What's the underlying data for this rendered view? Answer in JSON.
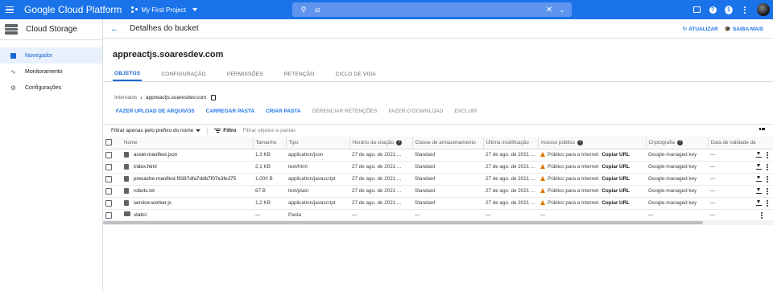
{
  "topbar": {
    "app_title": "Google Cloud Platform",
    "project": "My First Project",
    "search_value": "st",
    "notifications_count": "1"
  },
  "sidebar": {
    "title": "Cloud Storage",
    "items": [
      {
        "label": "Navegador",
        "icon": "bucket-icon",
        "active": true
      },
      {
        "label": "Monitoramento",
        "icon": "chart-icon",
        "active": false
      },
      {
        "label": "Configurações",
        "icon": "gear-icon",
        "active": false
      }
    ]
  },
  "header": {
    "title": "Detalhes do bucket",
    "refresh_label": "ATUALIZAR",
    "learn_label": "SAIBA MAIS"
  },
  "bucket": {
    "name": "appreactjs.soaresdev.com"
  },
  "tabs": [
    "OBJETOS",
    "CONFIGURAÇÃO",
    "PERMISSÕES",
    "RETENÇÃO",
    "CICLO DE VIDA"
  ],
  "breadcrumb": {
    "root": "Intervalos",
    "current": "appreactjs.soaresdev.com"
  },
  "actions": {
    "upload_files": "FAZER UPLOAD DE ARQUIVOS",
    "upload_folder": "CARREGAR PASTA",
    "create_folder": "CRIAR PASTA",
    "manage_retention": "GERENCIAR RETENÇÕES",
    "download": "FAZER O DOWNLOAD",
    "delete": "EXCLUIR"
  },
  "filter": {
    "select_label": "Filtrar apenas pelo prefixo do nome",
    "filter_label": "Filtro",
    "placeholder": "Filtrar objetos e pastas"
  },
  "table": {
    "columns": {
      "name": "Nome",
      "size": "Tamanho",
      "type": "Tipo",
      "created": "Horário da criação",
      "storage_class": "Classe de armazenamento",
      "modified": "Última modificação",
      "public_access": "Acesso público",
      "encryption": "Criptografia",
      "retention": "Data de validade da"
    },
    "rows": [
      {
        "name": "asset-manifest.json",
        "size": "1,3 KB",
        "type": "application/json",
        "created": "27 de ago. de 2021 ...",
        "storage_class": "Standard",
        "modified": "27 de ago. de 2021 ...",
        "access": "Público para a Internet",
        "copy": "Copiar URL",
        "encryption": "Google-managed key",
        "retention": "—"
      },
      {
        "name": "index.html",
        "size": "2,1 KB",
        "type": "text/html",
        "created": "27 de ago. de 2021 ...",
        "storage_class": "Standard",
        "modified": "27 de ago. de 2021 ...",
        "access": "Público para a Internet",
        "copy": "Copiar URL",
        "encryption": "Google-managed key",
        "retention": "—"
      },
      {
        "name": "precache-manifest.f9387dfa7ddb7f07e3fe375",
        "size": "1.000 B",
        "type": "application/javascript",
        "created": "27 de ago. de 2021 ...",
        "storage_class": "Standard",
        "modified": "27 de ago. de 2021 ...",
        "access": "Público para a Internet",
        "copy": "Copiar URL",
        "encryption": "Google-managed key",
        "retention": "—"
      },
      {
        "name": "robots.txt",
        "size": "67 B",
        "type": "text/plain",
        "created": "27 de ago. de 2021 ...",
        "storage_class": "Standard",
        "modified": "27 de ago. de 2021 ...",
        "access": "Público para a Internet",
        "copy": "Copiar URL",
        "encryption": "Google-managed key",
        "retention": "—"
      },
      {
        "name": "service-worker.js",
        "size": "1,2 KB",
        "type": "application/javascript",
        "created": "27 de ago. de 2021 ...",
        "storage_class": "Standard",
        "modified": "27 de ago. de 2021 ...",
        "access": "Público para a Internet",
        "copy": "Copiar URL",
        "encryption": "Google-managed key",
        "retention": "—"
      }
    ],
    "folder_row": {
      "name": "static/",
      "size": "—",
      "type": "Pasta",
      "created": "—",
      "storage_class": "—",
      "modified": "—",
      "access": "—",
      "encryption": "—",
      "retention": "—"
    }
  },
  "colors": {
    "accent": "#1a73e8",
    "warning": "#e37400"
  }
}
